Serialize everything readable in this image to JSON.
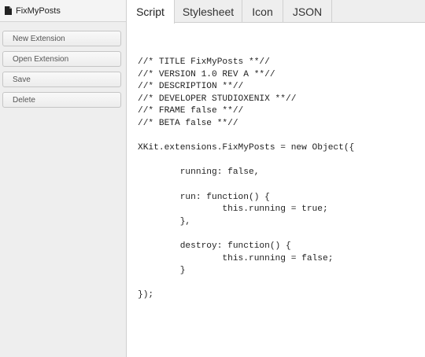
{
  "sidebar": {
    "title": "FixMyPosts",
    "title_icon": "file-icon",
    "buttons": {
      "new_extension": "New Extension",
      "open_extension": "Open Extension",
      "save": "Save",
      "delete": "Delete"
    }
  },
  "tabs": {
    "script": "Script",
    "stylesheet": "Stylesheet",
    "icon": "Icon",
    "json": "JSON",
    "active": "Script"
  },
  "editor": {
    "code": "//* TITLE FixMyPosts **//\n//* VERSION 1.0 REV A **//\n//* DESCRIPTION **//\n//* DEVELOPER STUDIOXENIX **//\n//* FRAME false **//\n//* BETA false **//\n\nXKit.extensions.FixMyPosts = new Object({\n\n        running: false,\n\n        run: function() {\n                this.running = true;\n        },\n\n        destroy: function() {\n                this.running = false;\n        }\n\n});"
  },
  "colors": {
    "sidebar_bg": "#eeeeee",
    "tab_active_bg": "#ffffff",
    "border": "#cfcfcf"
  }
}
